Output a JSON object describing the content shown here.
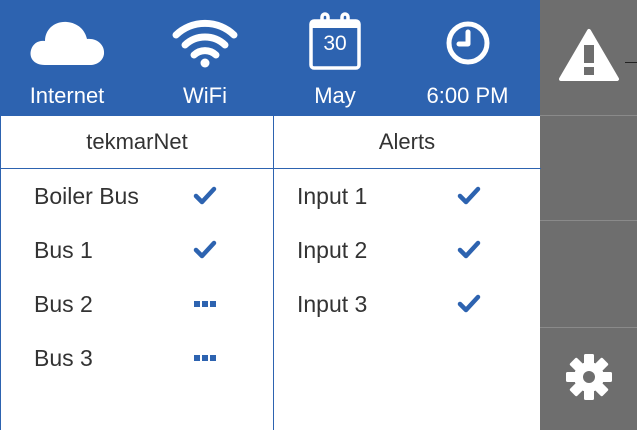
{
  "header": {
    "internet_label": "Internet",
    "wifi_label": "WiFi",
    "calendar_day": "30",
    "calendar_month": "May",
    "time": "6:00 PM",
    "bg_color": "#2d63b0"
  },
  "sidebar": {
    "bg_color": "#6e6e6e",
    "buttons": [
      "alert-icon",
      "",
      "",
      "settings-icon"
    ]
  },
  "tekmarnet": {
    "heading": "tekmarNet",
    "rows": [
      {
        "label": "Boiler Bus",
        "status": "check"
      },
      {
        "label": "Bus 1",
        "status": "check"
      },
      {
        "label": "Bus 2",
        "status": "dots"
      },
      {
        "label": "Bus 3",
        "status": "dots"
      }
    ]
  },
  "alerts": {
    "heading": "Alerts",
    "rows": [
      {
        "label": "Input 1",
        "status": "check"
      },
      {
        "label": "Input 2",
        "status": "check"
      },
      {
        "label": "Input 3",
        "status": "check"
      }
    ]
  }
}
